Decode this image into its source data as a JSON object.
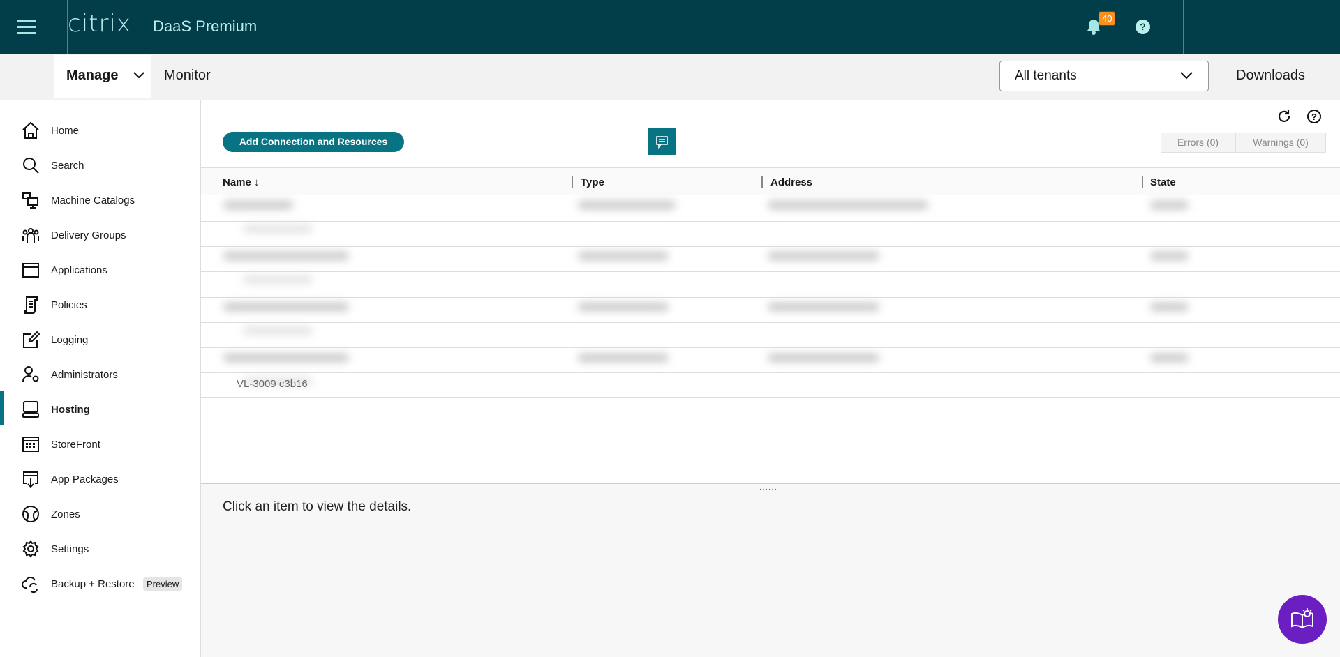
{
  "header": {
    "logo": "citrix",
    "product": "DaaS Premium",
    "notification_count": "40",
    "help": "?"
  },
  "subnav": {
    "manage": "Manage",
    "monitor": "Monitor",
    "tenant_select": "All tenants",
    "downloads": "Downloads"
  },
  "sidebar": {
    "items": [
      {
        "label": "Home",
        "icon": "home-icon"
      },
      {
        "label": "Search",
        "icon": "search-icon"
      },
      {
        "label": "Machine Catalogs",
        "icon": "machine-catalogs-icon"
      },
      {
        "label": "Delivery Groups",
        "icon": "delivery-groups-icon"
      },
      {
        "label": "Applications",
        "icon": "applications-icon"
      },
      {
        "label": "Policies",
        "icon": "policies-icon"
      },
      {
        "label": "Logging",
        "icon": "logging-icon"
      },
      {
        "label": "Administrators",
        "icon": "administrators-icon"
      },
      {
        "label": "Hosting",
        "icon": "hosting-icon",
        "active": true
      },
      {
        "label": "StoreFront",
        "icon": "storefront-icon"
      },
      {
        "label": "App Packages",
        "icon": "app-packages-icon"
      },
      {
        "label": "Zones",
        "icon": "zones-icon"
      },
      {
        "label": "Settings",
        "icon": "settings-icon"
      },
      {
        "label": "Backup + Restore",
        "icon": "backup-restore-icon",
        "badge": "Preview"
      }
    ]
  },
  "toolbar": {
    "add_button": "Add Connection and Resources",
    "errors": "Errors (0)",
    "warnings": "Warnings (0)"
  },
  "table": {
    "columns": [
      "Name",
      "Type",
      "Address",
      "State"
    ],
    "sort_indicator": "↓",
    "footer_row": "VL-3009 c3b16"
  },
  "details": {
    "placeholder": "Click an item to view the details."
  },
  "colors": {
    "header": "#023d4a",
    "accent": "#077383",
    "assistant": "#6b1fc2",
    "badge": "#f7911e"
  }
}
